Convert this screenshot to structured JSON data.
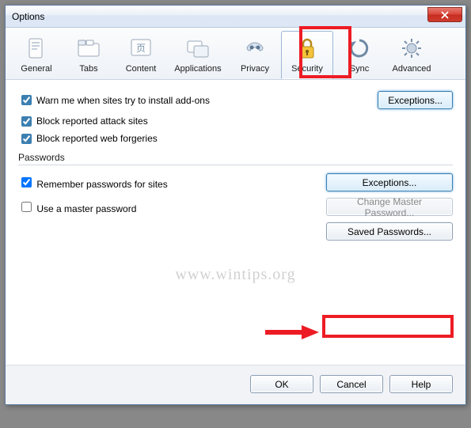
{
  "window": {
    "title": "Options"
  },
  "toolbar": {
    "items": [
      {
        "label": "General"
      },
      {
        "label": "Tabs"
      },
      {
        "label": "Content"
      },
      {
        "label": "Applications"
      },
      {
        "label": "Privacy"
      },
      {
        "label": "Security"
      },
      {
        "label": "Sync"
      },
      {
        "label": "Advanced"
      }
    ],
    "selected_index": 5
  },
  "security": {
    "warn_addons_label": "Warn me when sites try to install add-ons",
    "warn_addons_checked": true,
    "block_attack_label": "Block reported attack sites",
    "block_attack_checked": true,
    "block_forgeries_label": "Block reported web forgeries",
    "block_forgeries_checked": true,
    "exceptions_label": "Exceptions..."
  },
  "passwords": {
    "group_label": "Passwords",
    "remember_label": "Remember passwords for sites",
    "remember_checked": true,
    "master_label": "Use a master password",
    "master_checked": false,
    "exceptions_label": "Exceptions...",
    "change_master_label": "Change Master Password...",
    "saved_label": "Saved Passwords..."
  },
  "dialog": {
    "ok": "OK",
    "cancel": "Cancel",
    "help": "Help"
  },
  "watermark": "www.wintips.org"
}
